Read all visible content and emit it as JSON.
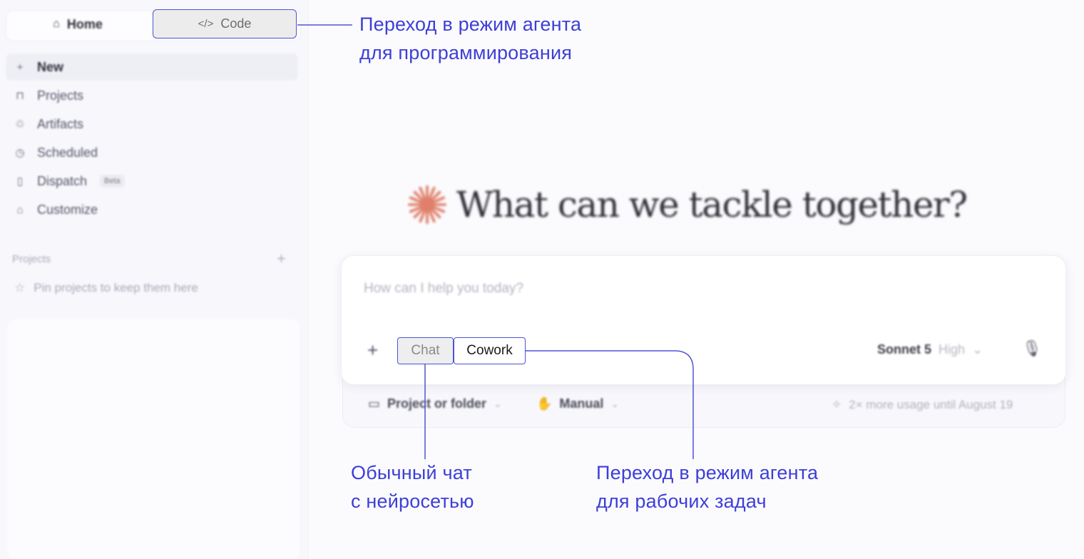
{
  "sidebar": {
    "tabs": {
      "home_label": "Home",
      "code_label": "Code"
    },
    "nav": [
      {
        "icon": "plus-icon",
        "glyph": "+",
        "label": "New"
      },
      {
        "icon": "briefcase-icon",
        "glyph": "⊓",
        "label": "Projects"
      },
      {
        "icon": "shapes-icon",
        "glyph": "♲",
        "label": "Artifacts"
      },
      {
        "icon": "clock-icon",
        "glyph": "◷",
        "label": "Scheduled"
      },
      {
        "icon": "phone-icon",
        "glyph": "▯",
        "label": "Dispatch",
        "badge": "Beta"
      },
      {
        "icon": "toolbox-icon",
        "glyph": "⌂",
        "label": "Customize"
      }
    ],
    "projects_section": {
      "title": "Projects",
      "add": "+",
      "hint": "Pin projects to keep them here"
    }
  },
  "main": {
    "heading": "What can we tackle together?",
    "composer": {
      "placeholder": "How can I help you today?",
      "plus": "+",
      "mode_chat": "Chat",
      "mode_cowork": "Cowork",
      "model": "Sonnet 5",
      "effort": "High",
      "effort_chevron": "⌄",
      "mic": "🎙"
    },
    "footer": {
      "project_label": "Project or folder",
      "permission_label": "Manual",
      "usage_text": "2× more usage until August 19"
    }
  },
  "annotations": {
    "code": [
      "Переход в режим агента",
      "для программирования"
    ],
    "chat": [
      "Обычный чат",
      "с нейросетью"
    ],
    "cowork": [
      "Переход в режим агента",
      "для рабочих задач"
    ]
  },
  "colors": {
    "annotation": "#3d3fd6",
    "accent_star": "#e0806a"
  }
}
